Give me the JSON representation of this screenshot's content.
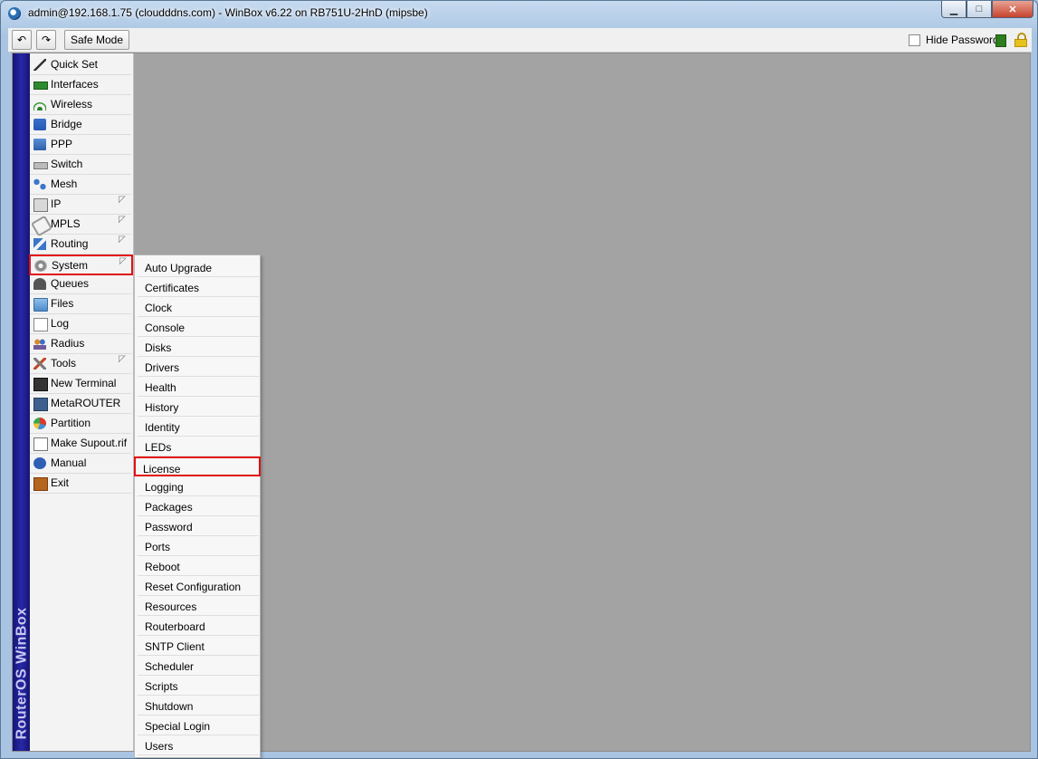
{
  "window": {
    "title": "admin@192.168.1.75 (cloudddns.com) - WinBox v6.22 on RB751U-2HnD (mipsbe)",
    "controls": {
      "minimize": "▁",
      "maximize": "□",
      "close": "✕"
    }
  },
  "toolbar": {
    "undo_icon": "↶",
    "redo_icon": "↷",
    "safe_mode_label": "Safe Mode",
    "hide_passwords_label": "Hide Passwords",
    "hide_passwords_checked": false
  },
  "brand": {
    "vertical_text": "RouterOS WinBox"
  },
  "sidebar": {
    "items": [
      {
        "label": "Quick Set",
        "icon": "wand-icon",
        "has_submenu": false
      },
      {
        "label": "Interfaces",
        "icon": "interfaces-icon",
        "has_submenu": false
      },
      {
        "label": "Wireless",
        "icon": "wireless-icon",
        "has_submenu": false
      },
      {
        "label": "Bridge",
        "icon": "bridge-icon",
        "has_submenu": false
      },
      {
        "label": "PPP",
        "icon": "ppp-icon",
        "has_submenu": false
      },
      {
        "label": "Switch",
        "icon": "switch-icon",
        "has_submenu": false
      },
      {
        "label": "Mesh",
        "icon": "mesh-icon",
        "has_submenu": false
      },
      {
        "label": "IP",
        "icon": "ip-icon",
        "has_submenu": true
      },
      {
        "label": "MPLS",
        "icon": "mpls-icon",
        "has_submenu": true
      },
      {
        "label": "Routing",
        "icon": "routing-icon",
        "has_submenu": true
      },
      {
        "label": "System",
        "icon": "gear-icon",
        "has_submenu": true,
        "selected": true
      },
      {
        "label": "Queues",
        "icon": "queues-icon",
        "has_submenu": false
      },
      {
        "label": "Files",
        "icon": "folder-icon",
        "has_submenu": false
      },
      {
        "label": "Log",
        "icon": "log-icon",
        "has_submenu": false
      },
      {
        "label": "Radius",
        "icon": "radius-icon",
        "has_submenu": false
      },
      {
        "label": "Tools",
        "icon": "tools-icon",
        "has_submenu": true
      },
      {
        "label": "New Terminal",
        "icon": "terminal-icon",
        "has_submenu": false
      },
      {
        "label": "MetaROUTER",
        "icon": "metarouter-icon",
        "has_submenu": false
      },
      {
        "label": "Partition",
        "icon": "partition-icon",
        "has_submenu": false
      },
      {
        "label": "Make Supout.rif",
        "icon": "supout-icon",
        "has_submenu": false
      },
      {
        "label": "Manual",
        "icon": "help-icon",
        "has_submenu": false
      },
      {
        "label": "Exit",
        "icon": "exit-icon",
        "has_submenu": false
      }
    ],
    "submenu_arrow": "◸"
  },
  "system_submenu": {
    "items": [
      {
        "label": "Auto Upgrade"
      },
      {
        "label": "Certificates"
      },
      {
        "label": "Clock"
      },
      {
        "label": "Console"
      },
      {
        "label": "Disks"
      },
      {
        "label": "Drivers"
      },
      {
        "label": "Health"
      },
      {
        "label": "History"
      },
      {
        "label": "Identity"
      },
      {
        "label": "LEDs"
      },
      {
        "label": "License",
        "selected": true
      },
      {
        "label": "Logging"
      },
      {
        "label": "Packages"
      },
      {
        "label": "Password"
      },
      {
        "label": "Ports"
      },
      {
        "label": "Reboot"
      },
      {
        "label": "Reset Configuration"
      },
      {
        "label": "Resources"
      },
      {
        "label": "Routerboard"
      },
      {
        "label": "SNTP Client"
      },
      {
        "label": "Scheduler"
      },
      {
        "label": "Scripts"
      },
      {
        "label": "Shutdown"
      },
      {
        "label": "Special Login"
      },
      {
        "label": "Users"
      }
    ]
  },
  "colors": {
    "highlight": "#e31010",
    "brand_strip": "#2828a8",
    "workspace": "#a3a3a3"
  }
}
